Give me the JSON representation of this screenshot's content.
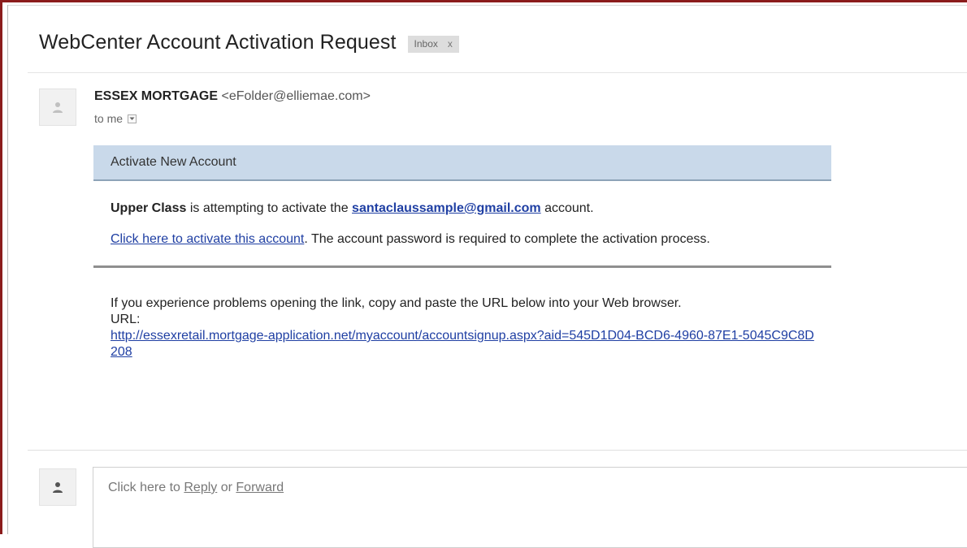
{
  "email": {
    "subject": "WebCenter Account Activation Request",
    "label": {
      "name": "Inbox",
      "remove": "x"
    },
    "sender": {
      "name": "ESSEX MORTGAGE",
      "email": "<eFolder@elliemae.com>"
    },
    "recipient": "to me",
    "body": {
      "banner": "Activate New Account",
      "p1": {
        "name": "Upper Class",
        "text1": " is attempting to activate the ",
        "account": "santaclaussample@gmail.com",
        "text2": " account."
      },
      "p2": {
        "link": "Click here to activate this account",
        "text": ". The account password is required to complete the activation process."
      },
      "p3": {
        "text": "If you experience problems opening the link, copy and paste the URL below into your Web browser.",
        "url_label": "URL:",
        "url": "http://essexretail.mortgage-application.net/myaccount/accountsignup.aspx?aid=545D1D04-BCD6-4960-87E1-5045C9C8D208"
      }
    },
    "reply": {
      "prefix": "Click here to ",
      "reply": "Reply",
      "or": " or ",
      "forward": "Forward"
    }
  },
  "colors": {
    "frame": "#8b1c1c",
    "banner": "#c9d9ea",
    "link": "#1f3fa3"
  },
  "icons": {
    "avatar": "person-icon",
    "dropdown": "chevron-down-icon"
  }
}
